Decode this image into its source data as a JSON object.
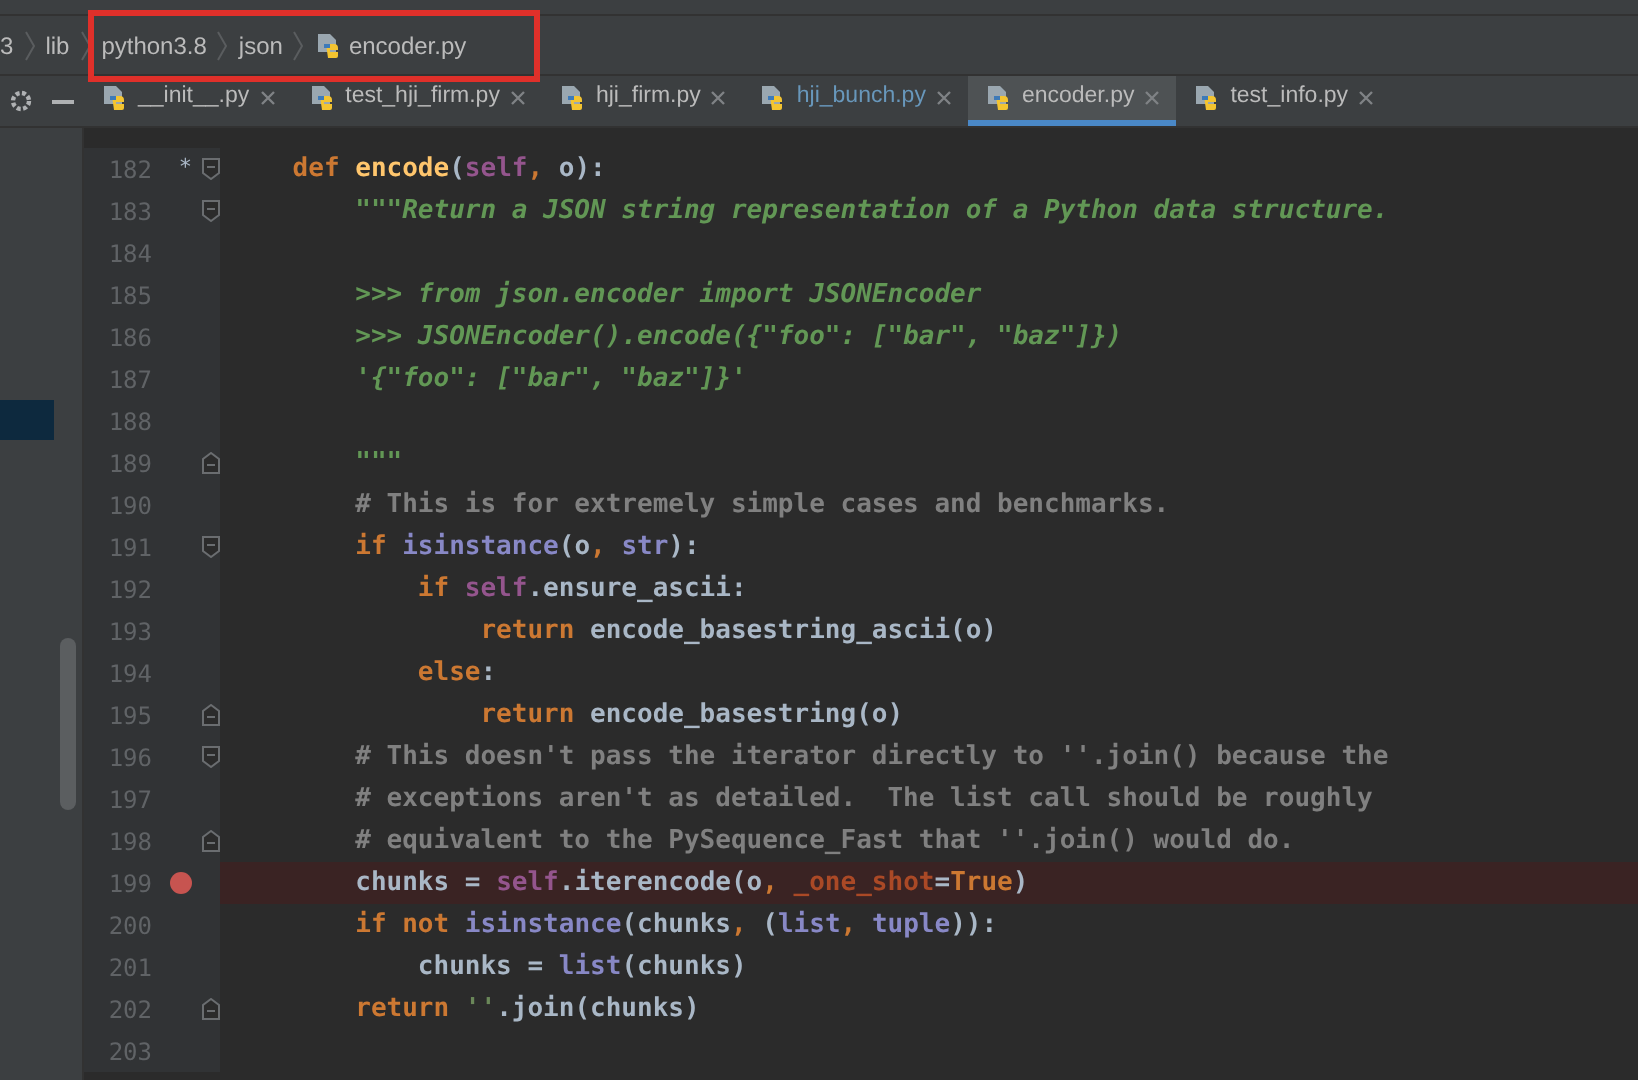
{
  "breadcrumbs": [
    {
      "label": "3",
      "kind": "folder"
    },
    {
      "label": "lib",
      "kind": "folder"
    },
    {
      "label": "python3.8",
      "kind": "folder"
    },
    {
      "label": "json",
      "kind": "folder"
    },
    {
      "label": "encoder.py",
      "kind": "file"
    }
  ],
  "tabs": [
    {
      "label": "__init__.py",
      "selected": false,
      "modified": false
    },
    {
      "label": "test_hji_firm.py",
      "selected": false,
      "modified": false
    },
    {
      "label": "hji_firm.py",
      "selected": false,
      "modified": false
    },
    {
      "label": "hji_bunch.py",
      "selected": false,
      "modified": true
    },
    {
      "label": "encoder.py",
      "selected": true,
      "modified": false
    },
    {
      "label": "test_info.py",
      "selected": false,
      "modified": false
    }
  ],
  "lines": [
    {
      "number": "182",
      "mark": "*",
      "breakpoint": false,
      "fold": {
        "kind": "start"
      },
      "tokens": [
        {
          "kind": "kw",
          "t": "    def "
        },
        {
          "kind": "fn",
          "t": "encode"
        },
        {
          "kind": "p",
          "t": "("
        },
        {
          "kind": "self",
          "t": "self"
        },
        {
          "kind": "kw",
          "t": ","
        },
        {
          "kind": "p",
          "t": " o):"
        }
      ]
    },
    {
      "number": "183",
      "breakpoint": false,
      "fold": {
        "kind": "start"
      },
      "tokens": [
        {
          "kind": "doc",
          "t": "        \"\"\"Return a JSON string representation of a Python data structure."
        }
      ]
    },
    {
      "number": "184",
      "breakpoint": false
    },
    {
      "number": "185",
      "breakpoint": false,
      "tokens": [
        {
          "kind": "doc",
          "t": "        >>> from json.encoder import JSONEncoder"
        }
      ]
    },
    {
      "number": "186",
      "breakpoint": false,
      "tokens": [
        {
          "kind": "doc",
          "t": "        >>> JSONEncoder().encode({\"foo\": [\"bar\", \"baz\"]})"
        }
      ]
    },
    {
      "number": "187",
      "breakpoint": false,
      "tokens": [
        {
          "kind": "doc",
          "t": "        '{\"foo\": [\"bar\", \"baz\"]}'"
        }
      ]
    },
    {
      "number": "188",
      "breakpoint": false
    },
    {
      "number": "189",
      "breakpoint": false,
      "fold": {
        "kind": "end"
      },
      "tokens": [
        {
          "kind": "doc",
          "t": "        \"\"\""
        }
      ]
    },
    {
      "number": "190",
      "breakpoint": false,
      "tokens": [
        {
          "kind": "com",
          "t": "        # This is for extremely simple cases and benchmarks."
        }
      ]
    },
    {
      "number": "191",
      "breakpoint": false,
      "fold": {
        "kind": "start"
      },
      "tokens": [
        {
          "kind": "kw",
          "t": "        if "
        },
        {
          "kind": "bi",
          "t": "isinstance"
        },
        {
          "kind": "p",
          "t": "(o"
        },
        {
          "kind": "kw",
          "t": ", "
        },
        {
          "kind": "bi",
          "t": "str"
        },
        {
          "kind": "p",
          "t": "):"
        }
      ]
    },
    {
      "number": "192",
      "breakpoint": false,
      "tokens": [
        {
          "kind": "kw",
          "t": "            if "
        },
        {
          "kind": "self",
          "t": "self"
        },
        {
          "kind": "p",
          "t": ".ensure_ascii:"
        }
      ]
    },
    {
      "number": "193",
      "breakpoint": false,
      "tokens": [
        {
          "kind": "kw",
          "t": "                return "
        },
        {
          "kind": "p",
          "t": "encode_basestring_ascii(o)"
        }
      ]
    },
    {
      "number": "194",
      "breakpoint": false,
      "tokens": [
        {
          "kind": "kw",
          "t": "            else"
        },
        {
          "kind": "p",
          "t": ":"
        }
      ]
    },
    {
      "number": "195",
      "breakpoint": false,
      "fold": {
        "kind": "end"
      },
      "tokens": [
        {
          "kind": "kw",
          "t": "                return "
        },
        {
          "kind": "p",
          "t": "encode_basestring(o)"
        }
      ]
    },
    {
      "number": "196",
      "breakpoint": false,
      "fold": {
        "kind": "start"
      },
      "tokens": [
        {
          "kind": "com",
          "t": "        # This doesn't pass the iterator directly to ''.join() because the"
        }
      ]
    },
    {
      "number": "197",
      "breakpoint": false,
      "tokens": [
        {
          "kind": "com",
          "t": "        # exceptions aren't as detailed.  The list call should be roughly"
        }
      ]
    },
    {
      "number": "198",
      "breakpoint": false,
      "fold": {
        "kind": "end"
      },
      "tokens": [
        {
          "kind": "com",
          "t": "        # equivalent to the PySequence_Fast that ''.join() would do."
        }
      ]
    },
    {
      "number": "199",
      "breakpoint": true,
      "tokens": [
        {
          "kind": "p",
          "t": "        chunks = "
        },
        {
          "kind": "self",
          "t": "self"
        },
        {
          "kind": "p",
          "t": ".iterencode(o"
        },
        {
          "kind": "kw",
          "t": ", "
        },
        {
          "kind": "param",
          "t": "_one_shot"
        },
        {
          "kind": "p",
          "t": "="
        },
        {
          "kind": "kw",
          "t": "True"
        },
        {
          "kind": "p",
          "t": ")"
        }
      ]
    },
    {
      "number": "200",
      "breakpoint": false,
      "tokens": [
        {
          "kind": "kw",
          "t": "        if not "
        },
        {
          "kind": "bi",
          "t": "isinstance"
        },
        {
          "kind": "p",
          "t": "(chunks"
        },
        {
          "kind": "kw",
          "t": ", "
        },
        {
          "kind": "p",
          "t": "("
        },
        {
          "kind": "bi",
          "t": "list"
        },
        {
          "kind": "kw",
          "t": ", "
        },
        {
          "kind": "bi",
          "t": "tuple"
        },
        {
          "kind": "p",
          "t": ")):"
        }
      ]
    },
    {
      "number": "201",
      "breakpoint": false,
      "tokens": [
        {
          "kind": "p",
          "t": "            chunks = "
        },
        {
          "kind": "bi",
          "t": "list"
        },
        {
          "kind": "p",
          "t": "(chunks)"
        }
      ]
    },
    {
      "number": "202",
      "breakpoint": false,
      "fold": {
        "kind": "end"
      },
      "tokens": [
        {
          "kind": "kw",
          "t": "        return "
        },
        {
          "kind": "str",
          "t": "''"
        },
        {
          "kind": "p",
          "t": ".join(chunks)"
        }
      ]
    },
    {
      "number": "203",
      "breakpoint": false
    }
  ]
}
